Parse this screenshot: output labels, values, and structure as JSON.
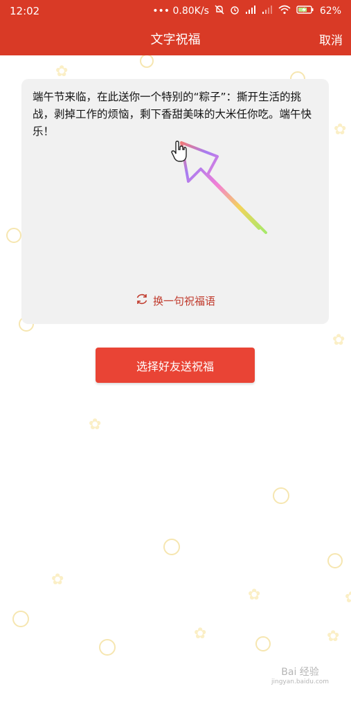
{
  "status_bar": {
    "time": "12:02",
    "network_speed": "••• 0.80K/s",
    "battery": "62%"
  },
  "header": {
    "title": "文字祝福",
    "cancel_label": "取消"
  },
  "card": {
    "message": "端午节来临，在此送你一个特别的“粽子”：撕开生活的挑战，剥掉工作的烦恼，剩下香甜美味的大米任你吃。端午快乐！",
    "change_label": "换一句祝福语"
  },
  "send_button_label": "选择好友送祝福",
  "watermark": {
    "brand": "Bai 经验",
    "url": "jingyan.baidu.com"
  },
  "colors": {
    "header_bg": "#d93a26",
    "button_bg": "#e94435",
    "card_bg": "#f1f1f1",
    "accent_text": "#c0392b"
  }
}
